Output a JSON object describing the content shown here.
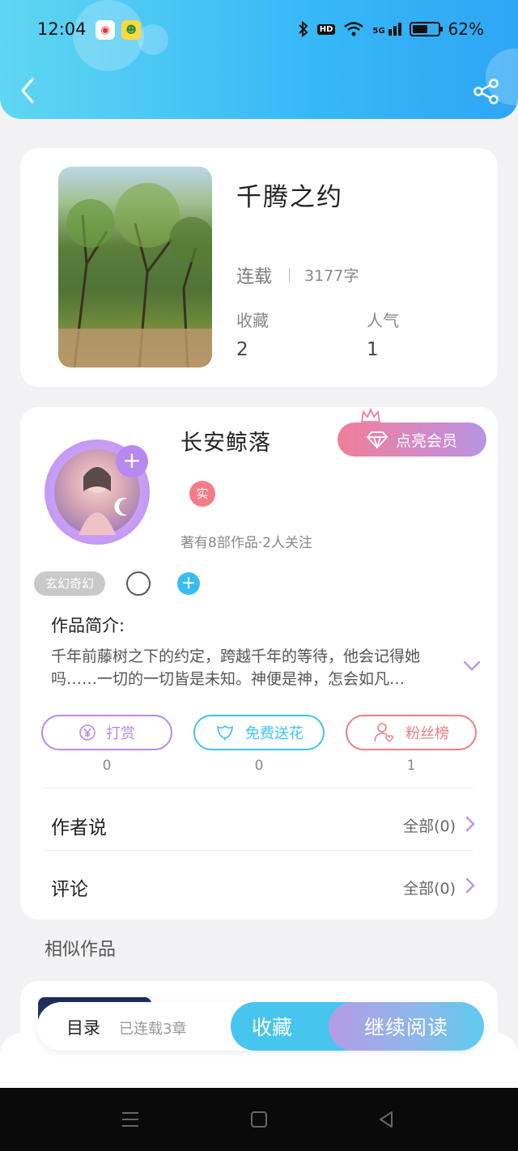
{
  "status_bar": {
    "time": "12:04",
    "network": "HD",
    "signal": "5G",
    "battery_percent": 62,
    "battery_text": "62%"
  },
  "header": {
    "back_icon": "chevron-left-icon",
    "share_icon": "share-icon"
  },
  "book": {
    "title": "千腾之约",
    "status": "连载",
    "word_count": "3177字",
    "favorites_label": "收藏",
    "favorites_value": "2",
    "popularity_label": "人气",
    "popularity_value": "1"
  },
  "author": {
    "name": "长安鲸落",
    "vip_label": "点亮会员",
    "real_badge": "实",
    "meta": "著有8部作品·2人关注",
    "tag": "玄幻奇幻"
  },
  "intro": {
    "title": "作品简介:",
    "text": "千年前藤树之下的约定，跨越千年的等待，他会记得她吗……一切的一切皆是未知。神便是神，怎会如凡…"
  },
  "actions": [
    {
      "label": "打赏",
      "count": "0",
      "icon": "yen-icon",
      "color": "#b88be8"
    },
    {
      "label": "免费送花",
      "count": "0",
      "icon": "flower-icon",
      "color": "#3fc4ea"
    },
    {
      "label": "粉丝榜",
      "count": "1",
      "icon": "fans-icon",
      "color": "#ee7e86"
    }
  ],
  "rows": {
    "author_says": {
      "label": "作者说",
      "link": "全部(0)"
    },
    "comments": {
      "label": "评论",
      "link": "全部(0)"
    }
  },
  "similar": {
    "title": "相似作品"
  },
  "bottom_bar": {
    "toc_label": "目录",
    "toc_info": "已连载3章",
    "favorite_label": "收藏",
    "read_label": "继续阅读"
  },
  "colors": {
    "header_start": "#5fd6f2",
    "header_end": "#2fa6f5",
    "accent_purple": "#b788ef",
    "accent_blue": "#38bdf2"
  }
}
